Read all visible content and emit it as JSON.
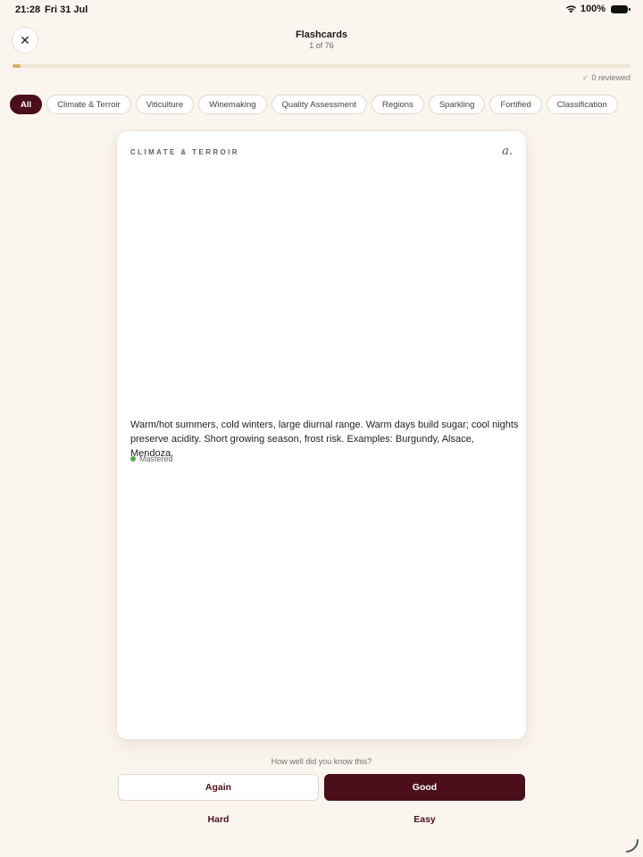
{
  "status_bar": {
    "time": "21:28",
    "date": "Fri 31 Jul",
    "battery": "100%"
  },
  "header": {
    "title": "Flashcards",
    "subtitle": "1 of 76",
    "close_label": "✕"
  },
  "progress": {
    "fraction": 0.013,
    "reviewed_label": "0 reviewed"
  },
  "chips": [
    {
      "label": "All",
      "active": true
    },
    {
      "label": "Climate & Terroir"
    },
    {
      "label": "Viticulture"
    },
    {
      "label": "Winemaking"
    },
    {
      "label": "Quality Assessment"
    },
    {
      "label": "Regions"
    },
    {
      "label": "Sparkling"
    },
    {
      "label": "Fortified"
    },
    {
      "label": "Classification"
    }
  ],
  "card": {
    "category": "CLIMATE & TERROIR",
    "logo": "a.",
    "answer": "Warm/hot summers, cold winters, large diurnal range. Warm days build sugar; cool nights preserve acidity. Short growing season, frost risk. Examples: Burgundy, Alsace, Mendoza.",
    "status": "Mastered"
  },
  "rating": {
    "prompt": "How well did you know this?",
    "again": "Again",
    "good": "Good",
    "hard": "Hard",
    "easy": "Easy"
  },
  "colors": {
    "accent": "#4a0f1b",
    "progress": "#d4b463",
    "background": "#faf6ef",
    "mastered": "#4caf50"
  }
}
